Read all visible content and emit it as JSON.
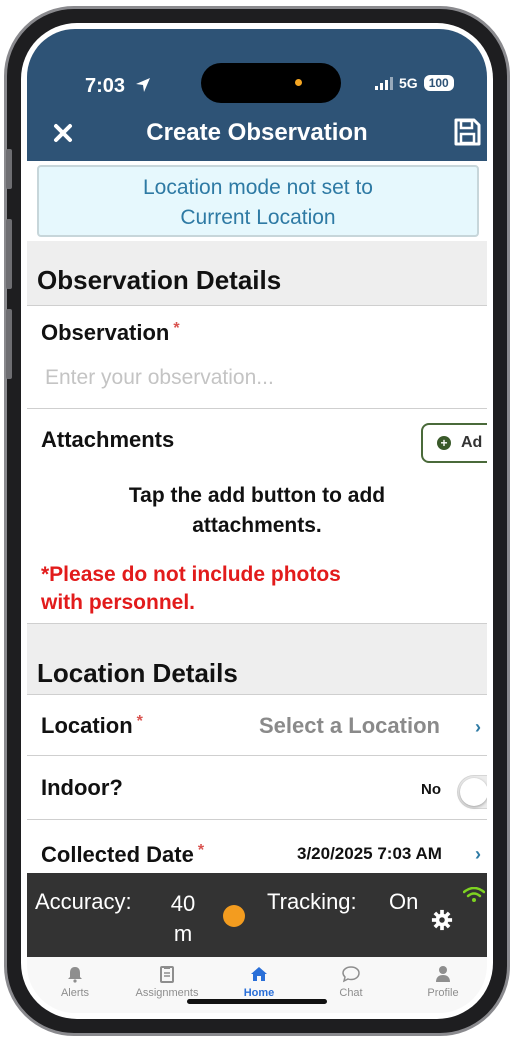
{
  "status_bar": {
    "time": "7:03",
    "network": "5G",
    "battery": "100"
  },
  "header": {
    "title": "Create Observation",
    "close_icon": "close-icon",
    "save_icon": "save-icon"
  },
  "banner": {
    "line1": "Location mode not set to",
    "line2": "Current Location"
  },
  "observation_section": {
    "title": "Observation Details",
    "observation_label": "Observation",
    "required_mark": "*",
    "observation_placeholder": "Enter your observation...",
    "attachments_label": "Attachments",
    "add_button_label": "Ad",
    "hint_line1": "Tap the add button to add",
    "hint_line2": "attachments.",
    "warning_line1": "*Please do not include photos",
    "warning_line2": "with personnel."
  },
  "location_section": {
    "title": "Location Details",
    "location_label": "Location",
    "location_value": "Select a Location",
    "indoor_label": "Indoor?",
    "indoor_value": "No",
    "collected_label": "Collected Date",
    "collected_value": "3/20/2025 7:03 AM"
  },
  "tracking_bar": {
    "accuracy_label": "Accuracy:",
    "accuracy_value_1": "40",
    "accuracy_value_2": "m",
    "tracking_label": "Tracking:",
    "tracking_value": "On",
    "colors": {
      "bar": "#333333",
      "gps_dot": "#f39c1f",
      "wifi": "#7ed321"
    }
  },
  "tabs": [
    {
      "label": "Alerts",
      "icon": "bell-icon",
      "active": false
    },
    {
      "label": "Assignments",
      "icon": "clipboard-icon",
      "active": false
    },
    {
      "label": "Home",
      "icon": "home-icon",
      "active": true
    },
    {
      "label": "Chat",
      "icon": "chat-icon",
      "active": false
    },
    {
      "label": "Profile",
      "icon": "user-icon",
      "active": false
    }
  ],
  "colors": {
    "header": "#2e5376",
    "banner_bg": "#e6f8fd",
    "banner_text": "#2e7aa4",
    "warning": "#e21b1b",
    "active_tab": "#2a6fd8"
  }
}
